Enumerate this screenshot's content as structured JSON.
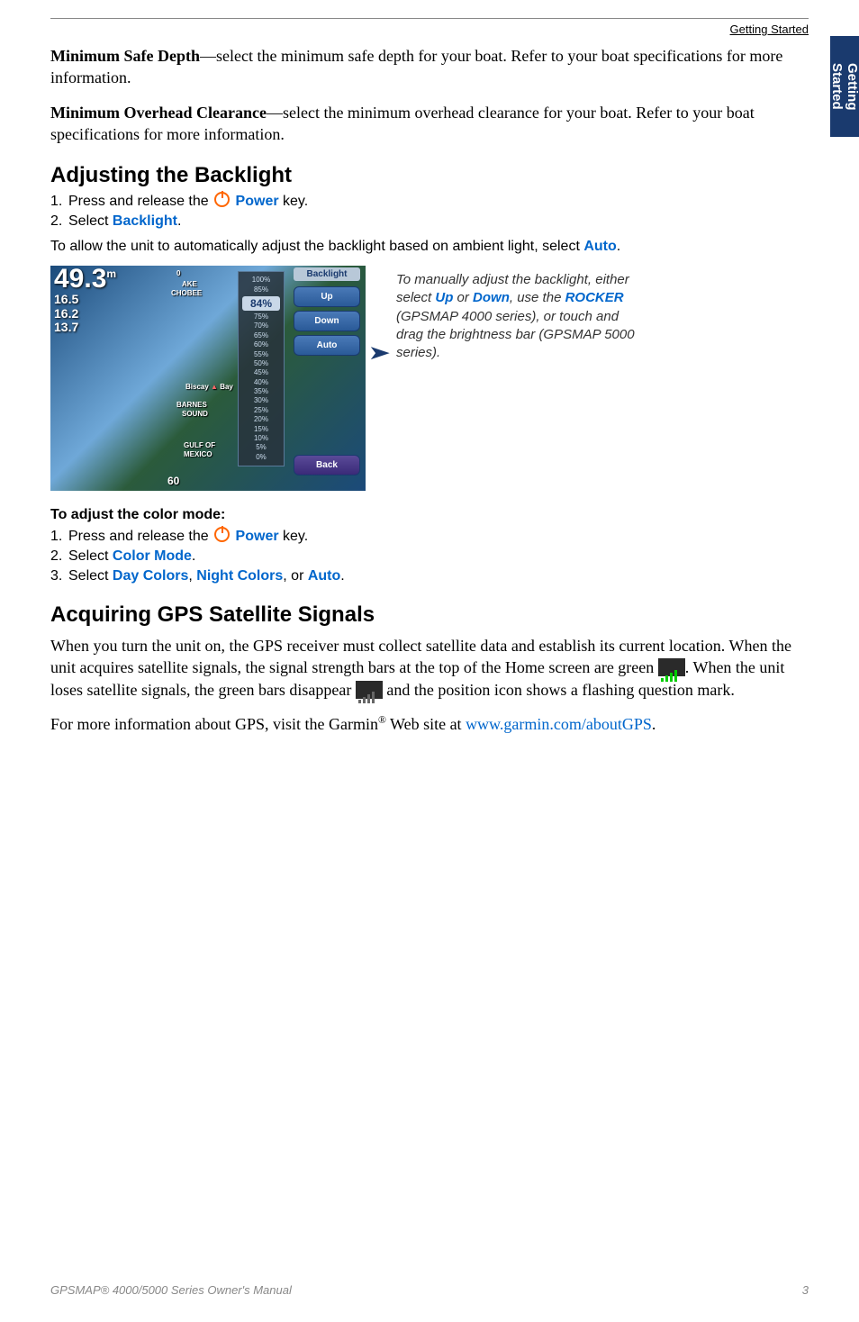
{
  "header": {
    "section": "Getting Started",
    "sideTab": "Getting Started"
  },
  "intro": {
    "p1_bold": "Minimum Safe Depth",
    "p1_rest": "—select the minimum safe depth for your boat. Refer to your boat specifications for more information.",
    "p2_bold": "Minimum Overhead Clearance",
    "p2_rest": "—select the minimum overhead clearance for your boat. Refer to your boat specifications for more information."
  },
  "backlight": {
    "heading": "Adjusting the Backlight",
    "step1_pre": "Press and release the ",
    "step1_key": "Power",
    "step1_post": " key.",
    "step2_pre": "Select ",
    "step2_key": "Backlight",
    "step2_post": ".",
    "note_pre": "To allow the unit to automatically adjust the backlight based on ambient light, select ",
    "note_key": "Auto",
    "note_post": "."
  },
  "screenshot": {
    "depth_main": "49.3",
    "depth_unit": "m",
    "depth_s1": "16.5",
    "depth_s2": "16.2",
    "depth_s3": "13.7",
    "scale_top": "0",
    "scale_bottom": "60",
    "map_chobee": "CHOBEE",
    "map_lake": "AKE",
    "map_biscay": "Biscay",
    "map_bay": "Bay",
    "map_barnes": "BARNES",
    "map_sound": "SOUND",
    "map_gulf": "GULF OF",
    "map_mexico": "MEXICO",
    "pct_100": "100%",
    "pct_85": "85%",
    "pct_current": "84%",
    "pct_list": [
      "75%",
      "70%",
      "65%",
      "60%",
      "55%",
      "50%",
      "45%",
      "40%",
      "35%",
      "30%",
      "25%",
      "20%",
      "15%",
      "10%",
      "5%",
      "0%"
    ],
    "panel_title": "Backlight",
    "btn_up": "Up",
    "btn_down": "Down",
    "btn_auto": "Auto",
    "btn_back": "Back"
  },
  "caption": {
    "l1": "To manually adjust the backlight, either select ",
    "up": "Up",
    "or": " or ",
    "down": "Down",
    "l2": ", use the ",
    "rocker": "ROCKER",
    "l3": " (GPSMAP 4000 series), or touch and drag the brightness bar (GPSMAP 5000 series)."
  },
  "colormode": {
    "heading": "To adjust the color mode:",
    "step1_pre": "Press and release the ",
    "step1_key": "Power",
    "step1_post": " key.",
    "step2_pre": "Select ",
    "step2_key": "Color Mode",
    "step2_post": ".",
    "step3_pre": "Select ",
    "step3_k1": "Day Colors",
    "step3_c1": ", ",
    "step3_k2": "Night Colors",
    "step3_c2": ", or ",
    "step3_k3": "Auto",
    "step3_post": "."
  },
  "gps": {
    "heading": "Acquiring GPS Satellite Signals",
    "p1_a": "When you turn the unit on, the GPS receiver must collect satellite data and establish its current location. When the unit acquires satellite signals, the signal strength bars at the top of the Home screen are green ",
    "p1_b": ". When the unit loses satellite signals, the green bars disappear ",
    "p1_c": " and the position icon shows a flashing question mark.",
    "p2_a": "For more information about GPS, visit the Garmin",
    "p2_b": " Web site at ",
    "link": "www.garmin.com/aboutGPS",
    "p2_c": "."
  },
  "footer": {
    "left": "GPSMAP® 4000/5000 Series Owner's Manual",
    "page": "3"
  }
}
